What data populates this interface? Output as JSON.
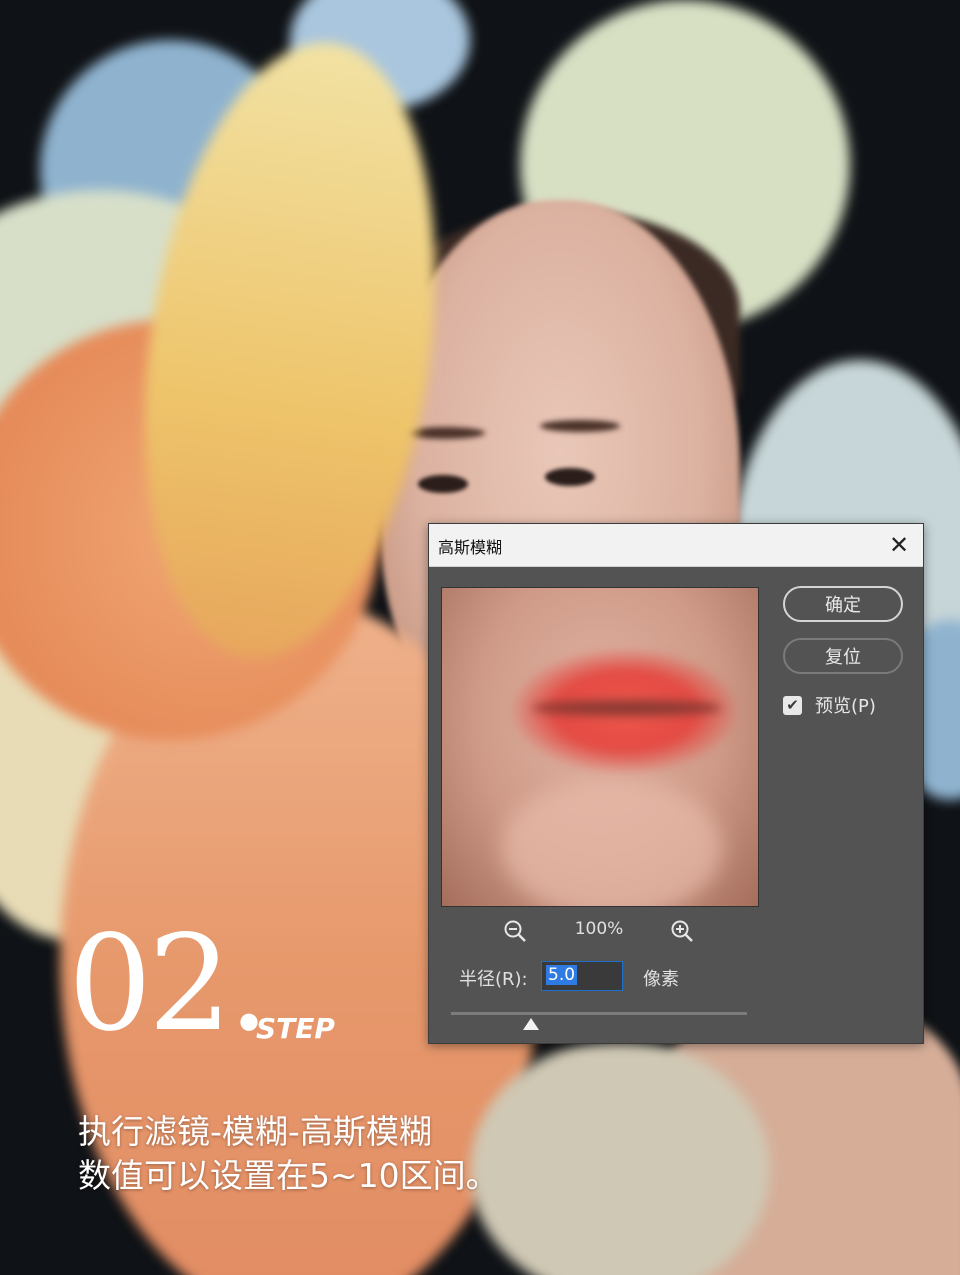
{
  "dialog": {
    "title": "高斯模糊",
    "close_glyph": "✕",
    "ok_label": "确定",
    "reset_label": "复位",
    "preview_label": "预览(P)",
    "preview_checked": true,
    "zoom_level": "100%",
    "radius_label": "半径(R):",
    "radius_value": "5.0",
    "unit_label": "像素",
    "slider_position": 0.27,
    "icons": [
      "close-icon",
      "zoom-out-icon",
      "zoom-in-icon",
      "checkbox-icon",
      "slider-thumb-icon"
    ]
  },
  "step": {
    "number": "02.",
    "word": "STEP"
  },
  "caption": {
    "line1": "执行滤镜-模糊-高斯模糊",
    "line2": "数值可以设置在5~10区间。"
  },
  "colors": {
    "dialog_bg": "#535353",
    "titlebar_bg": "#f2f2f2",
    "input_highlight": "#2e7be4",
    "text_light": "#e0e0e0"
  }
}
